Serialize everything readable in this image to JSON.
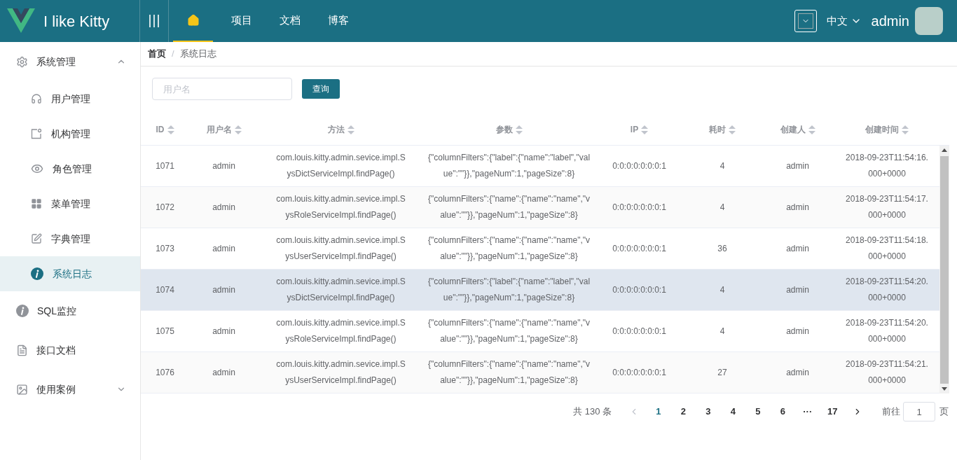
{
  "header": {
    "logo_text": "I like Kitty",
    "nav": [
      {
        "kind": "home",
        "selected": true
      },
      {
        "label": "项目",
        "kind": "text",
        "selected": false
      },
      {
        "label": "文档",
        "kind": "text",
        "selected": false
      },
      {
        "label": "博客",
        "kind": "text",
        "selected": false
      }
    ],
    "language": "中文",
    "user": "admin"
  },
  "sidebar": {
    "items": [
      {
        "label": "系统管理",
        "expanded": true,
        "selected": false,
        "children": [
          {
            "label": "用户管理",
            "selected": false
          },
          {
            "label": "机构管理",
            "selected": false
          },
          {
            "label": "角色管理",
            "selected": false
          },
          {
            "label": "菜单管理",
            "selected": false
          },
          {
            "label": "字典管理",
            "selected": false
          },
          {
            "label": "系统日志",
            "selected": true
          }
        ]
      },
      {
        "label": "SQL监控",
        "selected": false
      },
      {
        "label": "接口文档",
        "selected": false
      },
      {
        "label": "使用案例",
        "expanded": false,
        "selected": false
      }
    ]
  },
  "breadcrumb": {
    "items": [
      "首页",
      "系统日志"
    ],
    "separator": "/"
  },
  "search": {
    "placeholder": "用户名",
    "button": "查询"
  },
  "table": {
    "columns": [
      "ID",
      "用户名",
      "方法",
      "参数",
      "IP",
      "耗时",
      "创建人",
      "创建时间"
    ],
    "rows": [
      {
        "highlighted": false,
        "cells": [
          "1071",
          "admin",
          "com.louis.kitty.admin.sevice.impl.SysDictServiceImpl.findPage()",
          "{\"columnFilters\":{\"label\":{\"name\":\"label\",\"value\":\"\"}},\"pageNum\":1,\"pageSize\":8}",
          "0:0:0:0:0:0:0:1",
          "4",
          "admin",
          "2018-09-23T11:54:16.000+0000"
        ]
      },
      {
        "highlighted": false,
        "cells": [
          "1072",
          "admin",
          "com.louis.kitty.admin.sevice.impl.SysRoleServiceImpl.findPage()",
          "{\"columnFilters\":{\"name\":{\"name\":\"name\",\"value\":\"\"}},\"pageNum\":1,\"pageSize\":8}",
          "0:0:0:0:0:0:0:1",
          "4",
          "admin",
          "2018-09-23T11:54:17.000+0000"
        ]
      },
      {
        "highlighted": false,
        "cells": [
          "1073",
          "admin",
          "com.louis.kitty.admin.sevice.impl.SysUserServiceImpl.findPage()",
          "{\"columnFilters\":{\"name\":{\"name\":\"name\",\"value\":\"\"}},\"pageNum\":1,\"pageSize\":8}",
          "0:0:0:0:0:0:0:1",
          "36",
          "admin",
          "2018-09-23T11:54:18.000+0000"
        ]
      },
      {
        "highlighted": true,
        "cells": [
          "1074",
          "admin",
          "com.louis.kitty.admin.sevice.impl.SysDictServiceImpl.findPage()",
          "{\"columnFilters\":{\"label\":{\"name\":\"label\",\"value\":\"\"}},\"pageNum\":1,\"pageSize\":8}",
          "0:0:0:0:0:0:0:1",
          "4",
          "admin",
          "2018-09-23T11:54:20.000+0000"
        ]
      },
      {
        "highlighted": false,
        "cells": [
          "1075",
          "admin",
          "com.louis.kitty.admin.sevice.impl.SysRoleServiceImpl.findPage()",
          "{\"columnFilters\":{\"name\":{\"name\":\"name\",\"value\":\"\"}},\"pageNum\":1,\"pageSize\":8}",
          "0:0:0:0:0:0:0:1",
          "4",
          "admin",
          "2018-09-23T11:54:20.000+0000"
        ]
      },
      {
        "highlighted": false,
        "cells": [
          "1076",
          "admin",
          "com.louis.kitty.admin.sevice.impl.SysUserServiceImpl.findPage()",
          "{\"columnFilters\":{\"name\":{\"name\":\"name\",\"value\":\"\"}},\"pageNum\":1,\"pageSize\":8}",
          "0:0:0:0:0:0:0:1",
          "27",
          "admin",
          "2018-09-23T11:54:21.000+0000"
        ]
      }
    ]
  },
  "pagination": {
    "total": "共 130 条",
    "pages": [
      {
        "label": "1",
        "selected": true
      },
      {
        "label": "2",
        "selected": false
      },
      {
        "label": "3",
        "selected": false
      },
      {
        "label": "4",
        "selected": false
      },
      {
        "label": "5",
        "selected": false
      },
      {
        "label": "6",
        "selected": false
      },
      {
        "label": "···",
        "selected": false
      },
      {
        "label": "17",
        "selected": false
      }
    ],
    "goto": "前往",
    "page": "1",
    "unit": "页"
  }
}
